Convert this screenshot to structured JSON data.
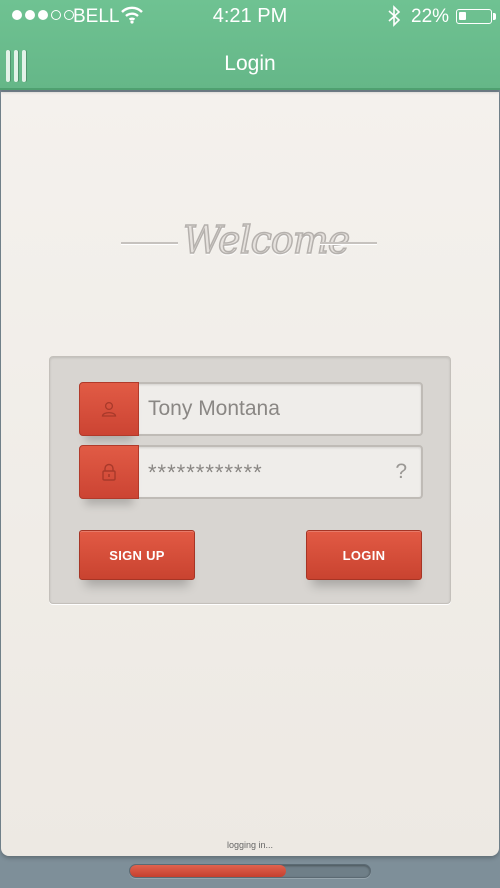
{
  "status_bar": {
    "carrier": "BELL",
    "time": "4:21 PM",
    "battery_percent": "22%",
    "signal_bars_filled": 3,
    "signal_bars_total": 5,
    "icons": [
      "wifi-icon",
      "bluetooth-icon",
      "battery-icon"
    ]
  },
  "nav": {
    "title": "Login",
    "menu_icon": "menu-icon"
  },
  "welcome": {
    "text": "Welcome"
  },
  "form": {
    "username": {
      "value": "Tony Montana",
      "icon": "user-icon"
    },
    "password": {
      "value": "************",
      "icon": "lock-icon",
      "help": "?"
    },
    "signup_label": "SIGN UP",
    "login_label": "LOGIN"
  },
  "loading": {
    "label": "logging in...",
    "progress": 0.65
  },
  "colors": {
    "nav_green": "#67b98a",
    "accent_red": "#d44e3b",
    "background": "#f1eee9"
  }
}
